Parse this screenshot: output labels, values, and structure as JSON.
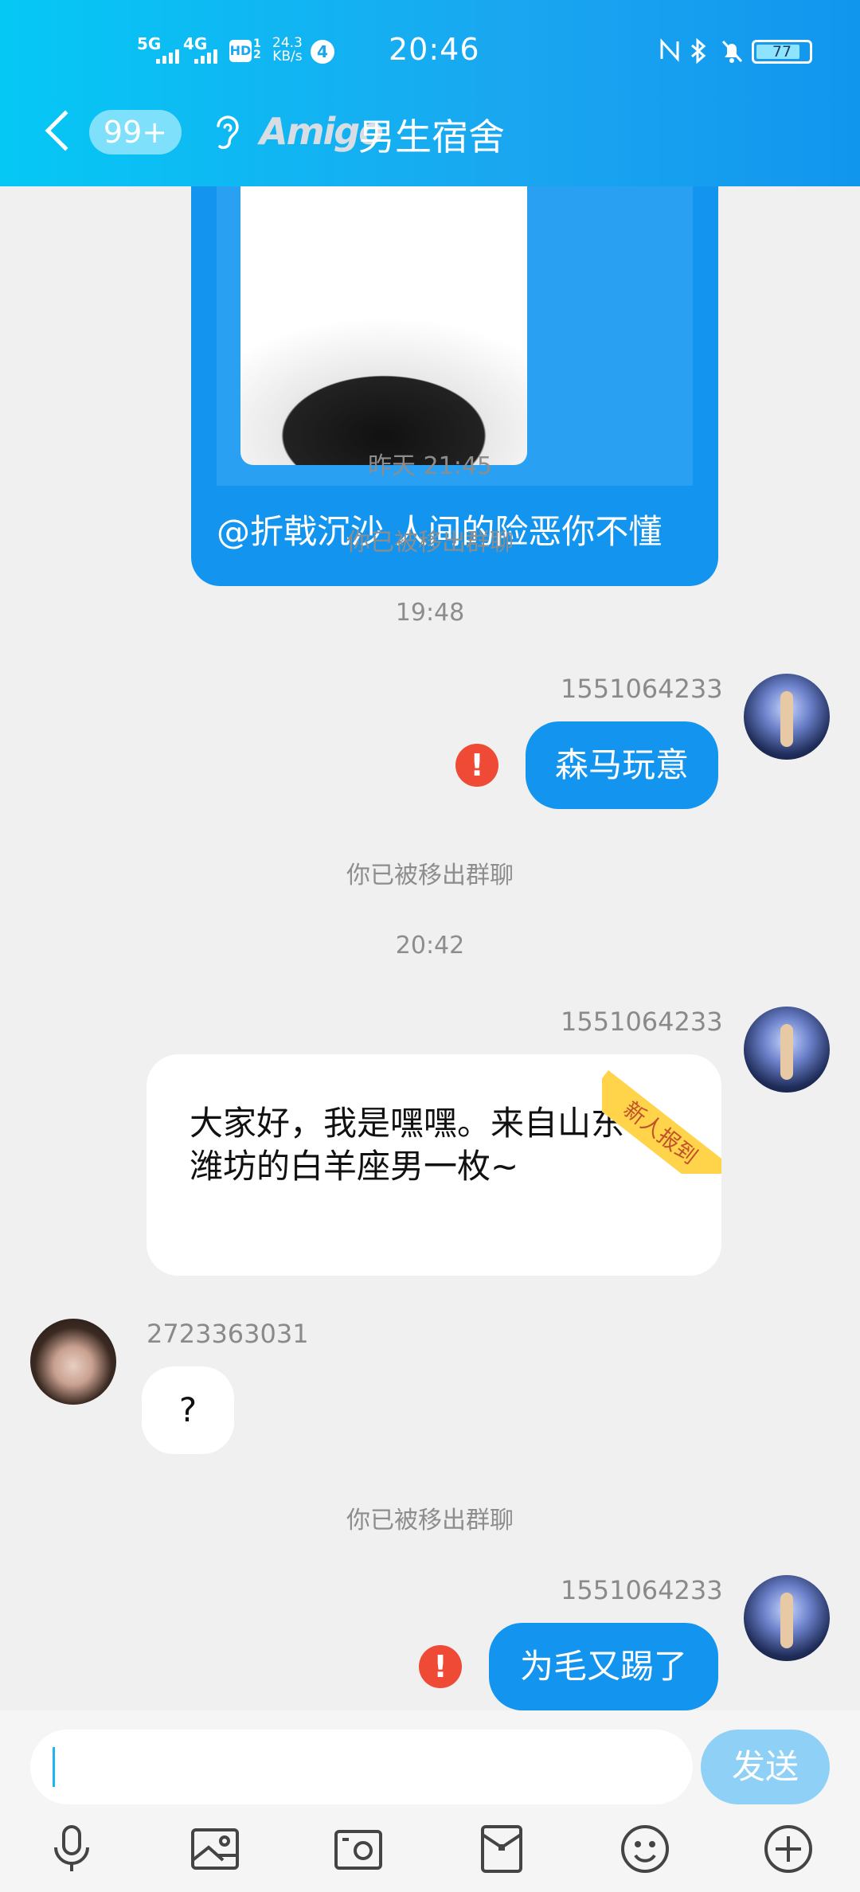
{
  "status_bar": {
    "network1": "5G",
    "network2": "4G",
    "hd": "HD",
    "sim": "1 2",
    "speed_value": "24.3",
    "speed_unit": "KB/s",
    "notification_count": "4",
    "time": "20:46",
    "battery": "77"
  },
  "nav": {
    "unread_badge": "99+",
    "group_brand": "Amigo",
    "group_title": "男生宿舍"
  },
  "chat": {
    "blue_card_caption": "@折戟沉沙 人间的险恶你不懂",
    "timestamp1": "昨天 21:45",
    "system_msg1": "你已被移出群聊",
    "timestamp2": "19:48",
    "msg1_sender": "1551064233",
    "msg1_text": "森马玩意",
    "system_msg2": "你已被移出群聊",
    "timestamp3": "20:42",
    "msg2_sender": "1551064233",
    "msg2_ribbon": "新人报到",
    "msg2_line1": "大家好，我是嘿嘿。来自山东",
    "msg2_line2": "潍坊的白羊座男一枚~",
    "msg3_sender": "2723363031",
    "msg3_text": "?",
    "system_msg3": "你已被移出群聊",
    "msg4_sender": "1551064233",
    "msg4_text": "为毛又踢了",
    "error_mark": "!"
  },
  "input": {
    "send_label": "发送",
    "tools": [
      "microphone-icon",
      "image-icon",
      "camera-icon",
      "red-packet-icon",
      "emoji-icon",
      "plus-icon"
    ]
  },
  "colors": {
    "header_start": "#05c8f5",
    "header_end": "#1196ee",
    "bubble_blue": "#1395ef",
    "error_red": "#ef4a35",
    "ribbon_yellow": "#ffd34a",
    "send_button": "#8fd1f6"
  }
}
